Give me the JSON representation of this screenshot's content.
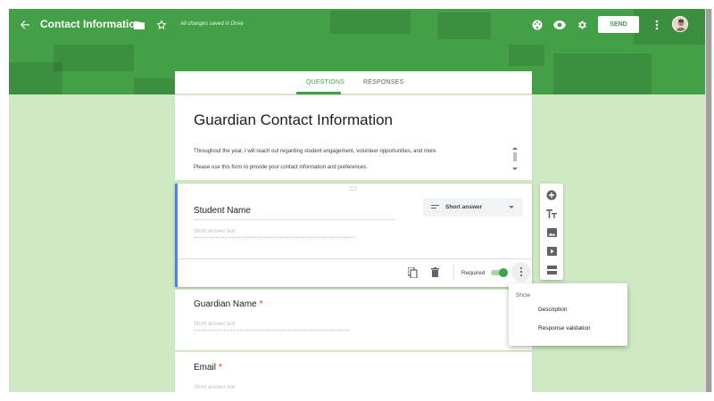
{
  "header": {
    "title": "Contact Information",
    "saved_status": "All changes saved in Drive",
    "send_label": "SEND",
    "accent": "#43a047",
    "icons": [
      "back-arrow-icon",
      "folder-icon",
      "star-icon",
      "palette-icon",
      "preview-eye-icon",
      "settings-gear-icon",
      "more-vert-icon"
    ]
  },
  "tabs": [
    {
      "label": "QUESTIONS",
      "active": true
    },
    {
      "label": "RESPONSES",
      "active": false
    }
  ],
  "form": {
    "title": "Guardian Contact Information",
    "description_lines": [
      "Throughout the year, I will reach out regarding student engagement, volunteer opportunities, and more.",
      "Please use this form to provide your contact information and preferences."
    ]
  },
  "questions": [
    {
      "title": "Student Name",
      "placeholder": "Short answer text",
      "type": "Short answer",
      "required": true,
      "selected": true
    },
    {
      "title": "Guardian Name",
      "placeholder": "Short answer text",
      "required": true
    },
    {
      "title": "Email",
      "placeholder": "Short answer text",
      "required": true
    }
  ],
  "active_question_footer": {
    "required_label": "Required"
  },
  "more_menu": {
    "header": "Show",
    "items": [
      "Description",
      "Response validation"
    ]
  },
  "side_toolbar": [
    "add-question-icon",
    "add-title-icon",
    "add-image-icon",
    "add-video-icon",
    "add-section-icon"
  ]
}
